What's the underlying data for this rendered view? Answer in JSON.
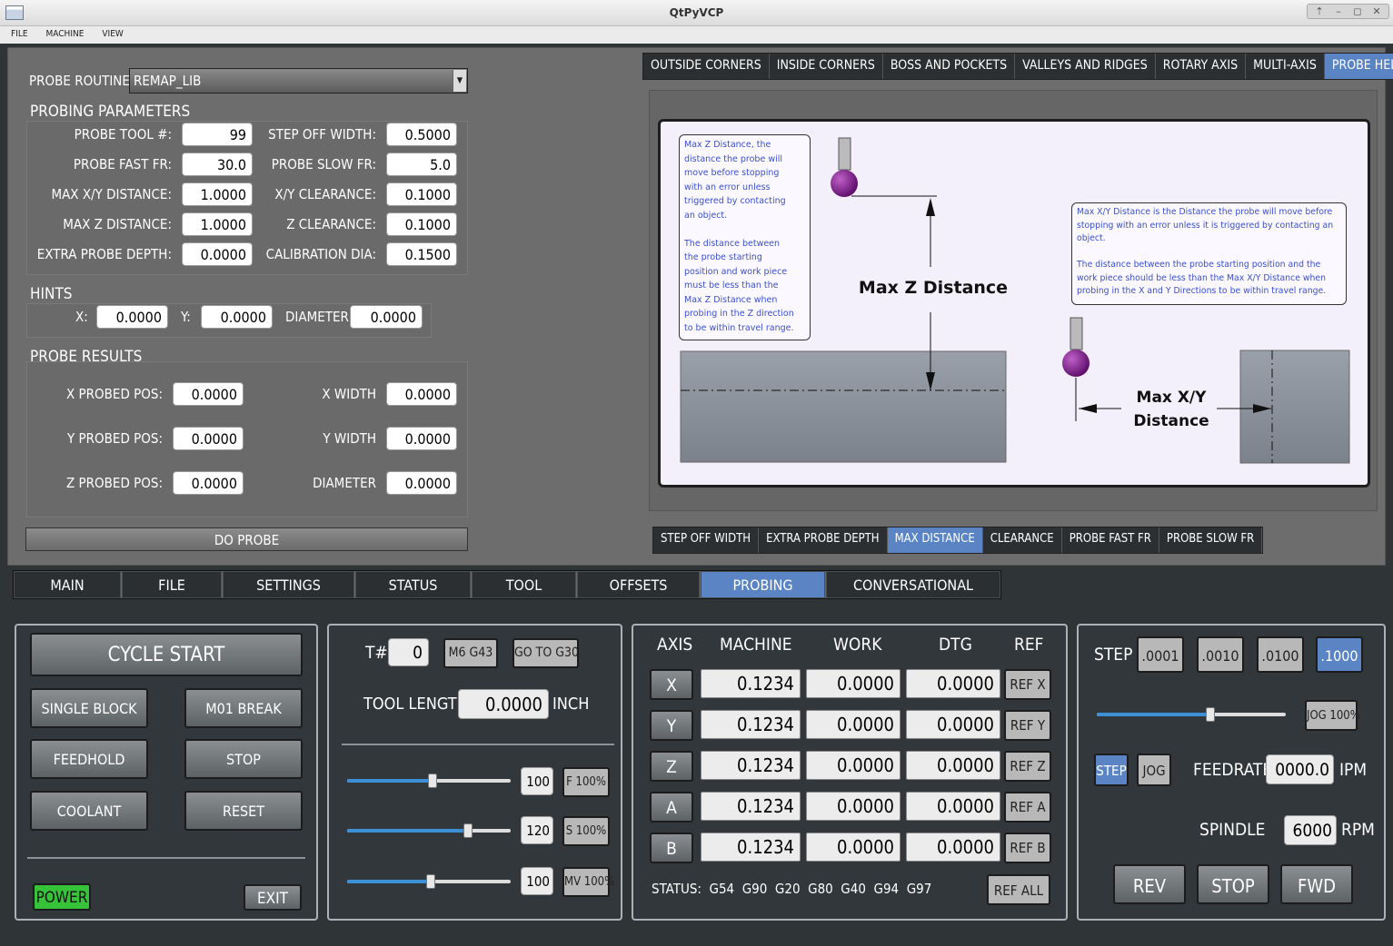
{
  "window": {
    "title": "QtPyVCP",
    "menu": [
      "FILE",
      "MACHINE",
      "VIEW"
    ]
  },
  "probe": {
    "routine_label": "PROBE ROUTINE:",
    "routine_value": "REMAP_LIB",
    "params_title": "PROBING PARAMETERS",
    "params": [
      {
        "label": "PROBE TOOL #:",
        "value": "99"
      },
      {
        "label": "STEP OFF WIDTH:",
        "value": "0.5000"
      },
      {
        "label": "PROBE FAST FR:",
        "value": "30.0"
      },
      {
        "label": "PROBE SLOW FR:",
        "value": "5.0"
      },
      {
        "label": "MAX X/Y DISTANCE:",
        "value": "1.0000"
      },
      {
        "label": "X/Y CLEARANCE:",
        "value": "0.1000"
      },
      {
        "label": "MAX Z DISTANCE:",
        "value": "1.0000"
      },
      {
        "label": "Z CLEARANCE:",
        "value": "0.1000"
      },
      {
        "label": "EXTRA PROBE DEPTH:",
        "value": "0.0000"
      },
      {
        "label": "CALIBRATION DIA:",
        "value": "0.1500"
      }
    ],
    "hints_title": "HINTS",
    "hints": {
      "x_label": "X:",
      "x": "0.0000",
      "y_label": "Y:",
      "y": "0.0000",
      "dia_label": "DIAMETER",
      "dia": "0.0000"
    },
    "results_title": "PROBE RESULTS",
    "results": [
      {
        "label": "X PROBED POS:",
        "value": "0.0000"
      },
      {
        "label": "X WIDTH",
        "value": "0.0000"
      },
      {
        "label": "Y PROBED POS:",
        "value": "0.0000"
      },
      {
        "label": "Y WIDTH",
        "value": "0.0000"
      },
      {
        "label": "Z PROBED POS:",
        "value": "0.0000"
      },
      {
        "label": "DIAMETER",
        "value": "0.0000"
      }
    ],
    "do_probe": "DO PROBE",
    "top_tabs": [
      "OUTSIDE CORNERS",
      "INSIDE CORNERS",
      "BOSS AND POCKETS",
      "VALLEYS AND RIDGES",
      "ROTARY AXIS",
      "MULTI-AXIS",
      "PROBE HELP"
    ],
    "top_tab_active": "PROBE HELP",
    "help": {
      "z_note": [
        "Max Z Distance, the",
        "distance the probe will",
        "move before stopping",
        "with an error unless",
        "triggered by contacting",
        "an object.",
        "",
        "The distance between",
        "the probe starting",
        "position and work piece",
        "must be less than the",
        "Max Z Distance when",
        "probing in the Z direction",
        "to be within travel range."
      ],
      "xy_note": [
        "Max X/Y Distance is the Distance the probe will move before",
        "stopping with an error unless it is triggered by contacting an",
        "object.",
        "",
        "The distance between the probe starting position and the",
        "work piece should be less than the Max X/Y Distance when",
        "probing in the X and Y Directions to be within travel range."
      ],
      "z_title": "Max Z Distance",
      "xy_title_1": "Max X/Y",
      "xy_title_2": "Distance"
    },
    "bottom_tabs": [
      "STEP OFF WIDTH",
      "EXTRA PROBE DEPTH",
      "MAX DISTANCE",
      "CLEARANCE",
      "PROBE FAST FR",
      "PROBE SLOW FR"
    ],
    "bottom_tab_active": "MAX DISTANCE"
  },
  "main_tabs": [
    "MAIN",
    "FILE",
    "SETTINGS",
    "STATUS",
    "TOOL",
    "OFFSETS",
    "PROBING",
    "CONVERSATIONAL"
  ],
  "main_tab_active": "PROBING",
  "controls": {
    "cycle_start": "CYCLE START",
    "single_block": "SINGLE BLOCK",
    "m01_break": "M01 BREAK",
    "feedhold": "FEEDHOLD",
    "stop": "STOP",
    "coolant": "COOLANT",
    "reset": "RESET",
    "power": "POWER",
    "exit": "EXIT"
  },
  "tool": {
    "t_label": "T#",
    "t_value": "0",
    "m6g43": "M6 G43",
    "goto_g30": "GO TO G30",
    "length_label": "TOOL LENGTH",
    "length_value": "0.0000",
    "length_unit": "INCH",
    "overrides": [
      {
        "value": "100",
        "button": "F 100%",
        "fraction": 0.52
      },
      {
        "value": "120",
        "button": "S 100%",
        "fraction": 0.74
      },
      {
        "value": "100",
        "button": "MV 100%",
        "fraction": 0.51
      }
    ]
  },
  "dro": {
    "headers": [
      "AXIS",
      "MACHINE",
      "WORK",
      "DTG",
      "REF"
    ],
    "rows": [
      {
        "axis": "X",
        "machine": "0.1234",
        "work": "0.0000",
        "dtg": "0.0000",
        "ref": "REF X"
      },
      {
        "axis": "Y",
        "machine": "0.1234",
        "work": "0.0000",
        "dtg": "0.0000",
        "ref": "REF Y"
      },
      {
        "axis": "Z",
        "machine": "0.1234",
        "work": "0.0000",
        "dtg": "0.0000",
        "ref": "REF Z"
      },
      {
        "axis": "A",
        "machine": "0.1234",
        "work": "0.0000",
        "dtg": "0.0000",
        "ref": "REF A"
      },
      {
        "axis": "B",
        "machine": "0.1234",
        "work": "0.0000",
        "dtg": "0.0000",
        "ref": "REF B"
      }
    ],
    "status": "STATUS:  G54  G90  G20  G80  G40  G94  G97",
    "ref_all": "REF ALL"
  },
  "jog": {
    "step_label": "STEP",
    "steps": [
      ".0001",
      ".0010",
      ".0100",
      ".1000"
    ],
    "step_active": ".1000",
    "jog_btn": "JOG 100%",
    "jog_fraction": 0.6,
    "step_mode": "STEP",
    "jog_mode": "JOG",
    "feed_label": "FEEDRATE",
    "feed_value": "0000.0",
    "feed_unit": "IPM",
    "spindle_label": "SPINDLE",
    "spindle_value": "6000",
    "spindle_unit": "RPM",
    "rev": "REV",
    "stop": "STOP",
    "fwd": "FWD"
  },
  "colors": {
    "accent": "#5a84c4",
    "power": "#36c33a"
  }
}
